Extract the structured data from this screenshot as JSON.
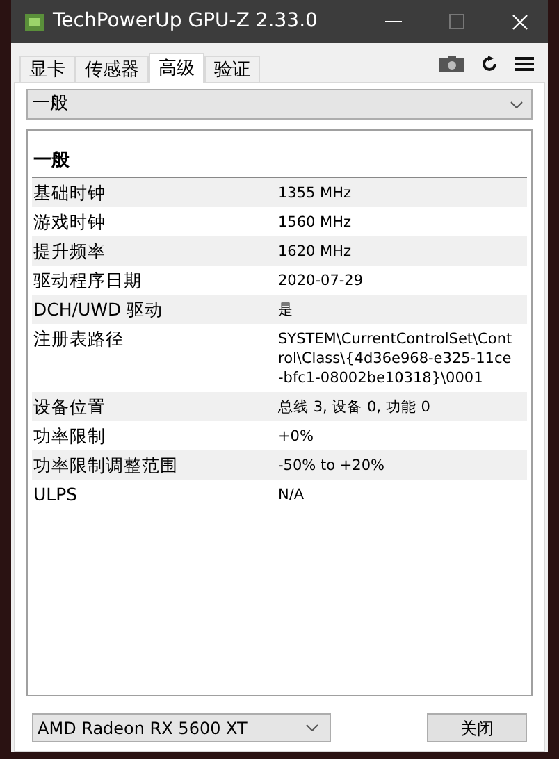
{
  "window": {
    "title": "TechPowerUp GPU-Z 2.33.0"
  },
  "tabs": [
    {
      "label": "显卡",
      "selected": false
    },
    {
      "label": "传感器",
      "selected": false
    },
    {
      "label": "高级",
      "selected": true
    },
    {
      "label": "验证",
      "selected": false
    }
  ],
  "section_dropdown": {
    "value": "一般"
  },
  "panel": {
    "heading": "一般",
    "rows": [
      {
        "label": "基础时钟",
        "value": "1355 MHz"
      },
      {
        "label": "游戏时钟",
        "value": "1560 MHz"
      },
      {
        "label": "提升频率",
        "value": "1620 MHz"
      },
      {
        "label": "驱动程序日期",
        "value": "2020-07-29"
      },
      {
        "label": "DCH/UWD 驱动",
        "value": "是"
      },
      {
        "label": "注册表路径",
        "value": "SYSTEM\\CurrentControlSet\\Control\\Class\\{4d36e968-e325-11ce-bfc1-08002be10318}\\0001"
      },
      {
        "label": "设备位置",
        "value": "总线 3, 设备 0, 功能 0"
      },
      {
        "label": "功率限制",
        "value": "+0%"
      },
      {
        "label": "功率限制调整范围",
        "value": "-50% to +20%"
      },
      {
        "label": "ULPS",
        "value": "N/A"
      }
    ]
  },
  "gpu_select": {
    "value": "AMD Radeon RX 5600 XT"
  },
  "close_button": {
    "label": "关闭"
  }
}
